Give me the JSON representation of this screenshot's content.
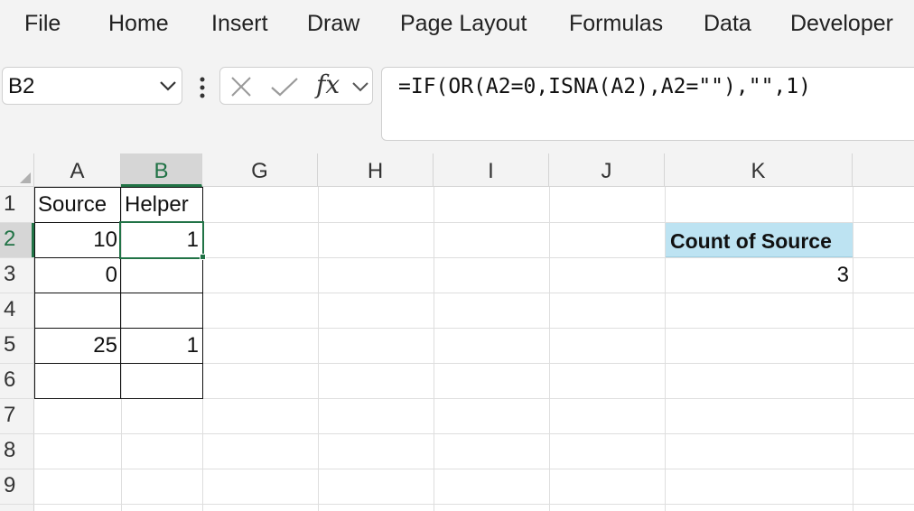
{
  "ribbon": {
    "tabs": [
      "File",
      "Home",
      "Insert",
      "Draw",
      "Page Layout",
      "Formulas",
      "Data",
      "Developer"
    ]
  },
  "formula_bar": {
    "name_box": "B2",
    "fx_label": "fx",
    "formula": "=IF(OR(A2=0,ISNA(A2),A2=\"\"),\"\",1)"
  },
  "columns": [
    "A",
    "B",
    "G",
    "H",
    "I",
    "J",
    "K"
  ],
  "rows": [
    "1",
    "2",
    "3",
    "4",
    "5",
    "6",
    "7",
    "8",
    "9"
  ],
  "selected_cell": {
    "column": "B",
    "row": "2"
  },
  "cells": {
    "A1": "Source",
    "B1": "Helper",
    "A2": "10",
    "B2": "1",
    "A3": "0",
    "A5": "25",
    "B5": "1",
    "K2": "Count of Source",
    "K3": "3"
  },
  "colors": {
    "accent": "#217346",
    "pivot_header": "#bde3f2"
  }
}
